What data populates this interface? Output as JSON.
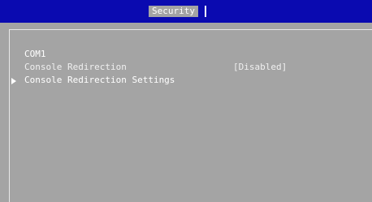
{
  "header": {
    "active_tab": "Security"
  },
  "content": {
    "section_title": "COM1",
    "items": [
      {
        "label": "Console Redirection",
        "value": "[Disabled]"
      }
    ],
    "submenus": [
      {
        "label": "Console Redirection Settings"
      }
    ]
  },
  "colors": {
    "header_bg": "#0a0ab0",
    "panel_bg": "#a4a4a4",
    "text": "#ffffff"
  }
}
